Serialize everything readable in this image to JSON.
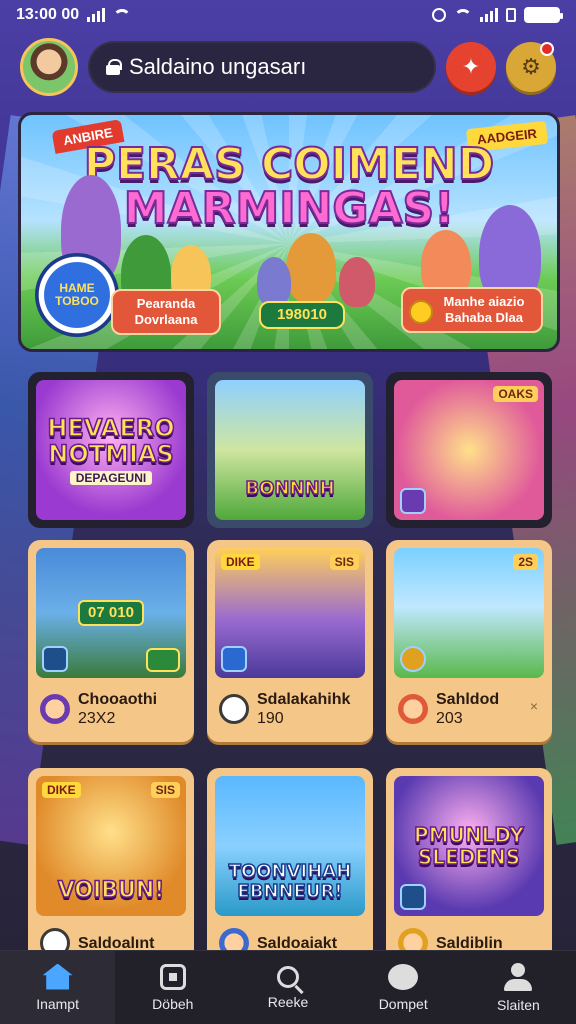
{
  "status_bar": {
    "time": "13:00 00"
  },
  "header": {
    "search_placeholder": "Saldaino ungasarı",
    "avatar_icon": "avatar",
    "action_icon": "puzzle-icon",
    "notify_icon": "bell-icon"
  },
  "banner": {
    "title_line1": "PERAS COIMEND",
    "title_line2": "MARMINGAS!",
    "flag_left": "ANBIRE",
    "flag_right": "AADGEIR",
    "badge": "HAME TOBOO",
    "pill_left": "Pearanda Dovrlaana",
    "pill_center": "198010",
    "pill_right": "Manhe aiazio Bahaba Dlaa"
  },
  "games": [
    {
      "title": "HEVAERO NOTMIAS",
      "subtitle": "DEPAGEUNI",
      "tag": "",
      "tag_left": ""
    },
    {
      "title": "BONNNH",
      "subtitle": "",
      "tag": "",
      "tag_left": ""
    },
    {
      "title": "",
      "subtitle": "",
      "tag": "OAKS",
      "tag_left": ""
    },
    {
      "title": "",
      "score": "07 010",
      "name": "Chooaothi",
      "meta": "23X2",
      "tag": "",
      "tag_left": ""
    },
    {
      "title": "",
      "name": "Sdalakahihk",
      "meta": "190",
      "tag": "SIS",
      "tag_left": "DIKE"
    },
    {
      "title": "",
      "name": "Sahldod",
      "meta": "203",
      "tag": "2S",
      "tag_left": "",
      "dismiss": "×"
    },
    {
      "title": "VOIBUN!",
      "name": "Saldoalınt",
      "tag": "SIS",
      "tag_left": "DIKE"
    },
    {
      "title": "TOONVIHAH EBNNEUR!",
      "name": "Saldoaiakt",
      "tag": "",
      "tag_left": ""
    },
    {
      "title": "PMUNLDY SLEDENS",
      "name": "Saldiblin",
      "tag": "",
      "tag_left": ""
    }
  ],
  "nav": {
    "items": [
      {
        "label": "Inampt",
        "icon": "home-icon"
      },
      {
        "label": "Döbeh",
        "icon": "games-icon"
      },
      {
        "label": "Reeke",
        "icon": "search-icon"
      },
      {
        "label": "Dompet",
        "icon": "community-icon"
      },
      {
        "label": "Slaiten",
        "icon": "profile-icon"
      }
    ]
  }
}
